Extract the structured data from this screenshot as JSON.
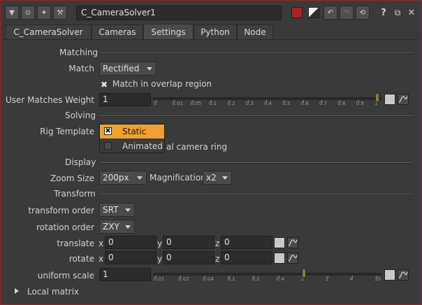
{
  "node": {
    "name": "C_CameraSolver1"
  },
  "tabs": [
    {
      "label": "C_CameraSolver"
    },
    {
      "label": "Cameras"
    },
    {
      "label": "Settings"
    },
    {
      "label": "Python"
    },
    {
      "label": "Node"
    }
  ],
  "sections": {
    "matching": "Matching",
    "solving": "Solving",
    "display": "Display",
    "transform": "Transform",
    "local_matrix": "Local matrix"
  },
  "matching": {
    "match_label": "Match",
    "match_value": "Rectified",
    "overlap_label": "Match in overlap region",
    "weight_label": "User Matches Weight",
    "weight_value": "1",
    "weight_ticks": [
      "0",
      "0.01",
      "0.05",
      "0.1",
      "0.2",
      "0.3",
      "0.4",
      "0.5",
      "0.6",
      "0.7",
      "0.8",
      "0.9",
      "1"
    ],
    "weight_fraction": 1.0
  },
  "solving": {
    "rig_label": "Rig Template",
    "options": [
      "Static",
      "Animated"
    ],
    "selected": "Static",
    "hidden_label": "al camera ring"
  },
  "display": {
    "zoom_label": "Zoom Size",
    "zoom_value": "200px",
    "mag_label": "Magnification",
    "mag_value": "x2"
  },
  "transform": {
    "order_label": "transform order",
    "order_value": "SRT",
    "rot_order_label": "rotation order",
    "rot_order_value": "ZXY",
    "translate_label": "translate",
    "translate": {
      "x": "0",
      "y": "0",
      "z": "0"
    },
    "rotate_label": "rotate",
    "rotate": {
      "x": "0",
      "y": "0",
      "z": "0"
    },
    "axis": {
      "x": "x",
      "y": "y",
      "z": "z"
    },
    "scale_label": "uniform scale",
    "scale_value": "1",
    "scale_ticks": [
      "0.01",
      "0.02",
      "0.04",
      "0.1",
      "0.2",
      "0.4",
      "1",
      "2",
      "4",
      "10"
    ],
    "scale_value_num": 1
  },
  "colors": {
    "accent": "#f0a030",
    "border": "#8a2a2a"
  }
}
